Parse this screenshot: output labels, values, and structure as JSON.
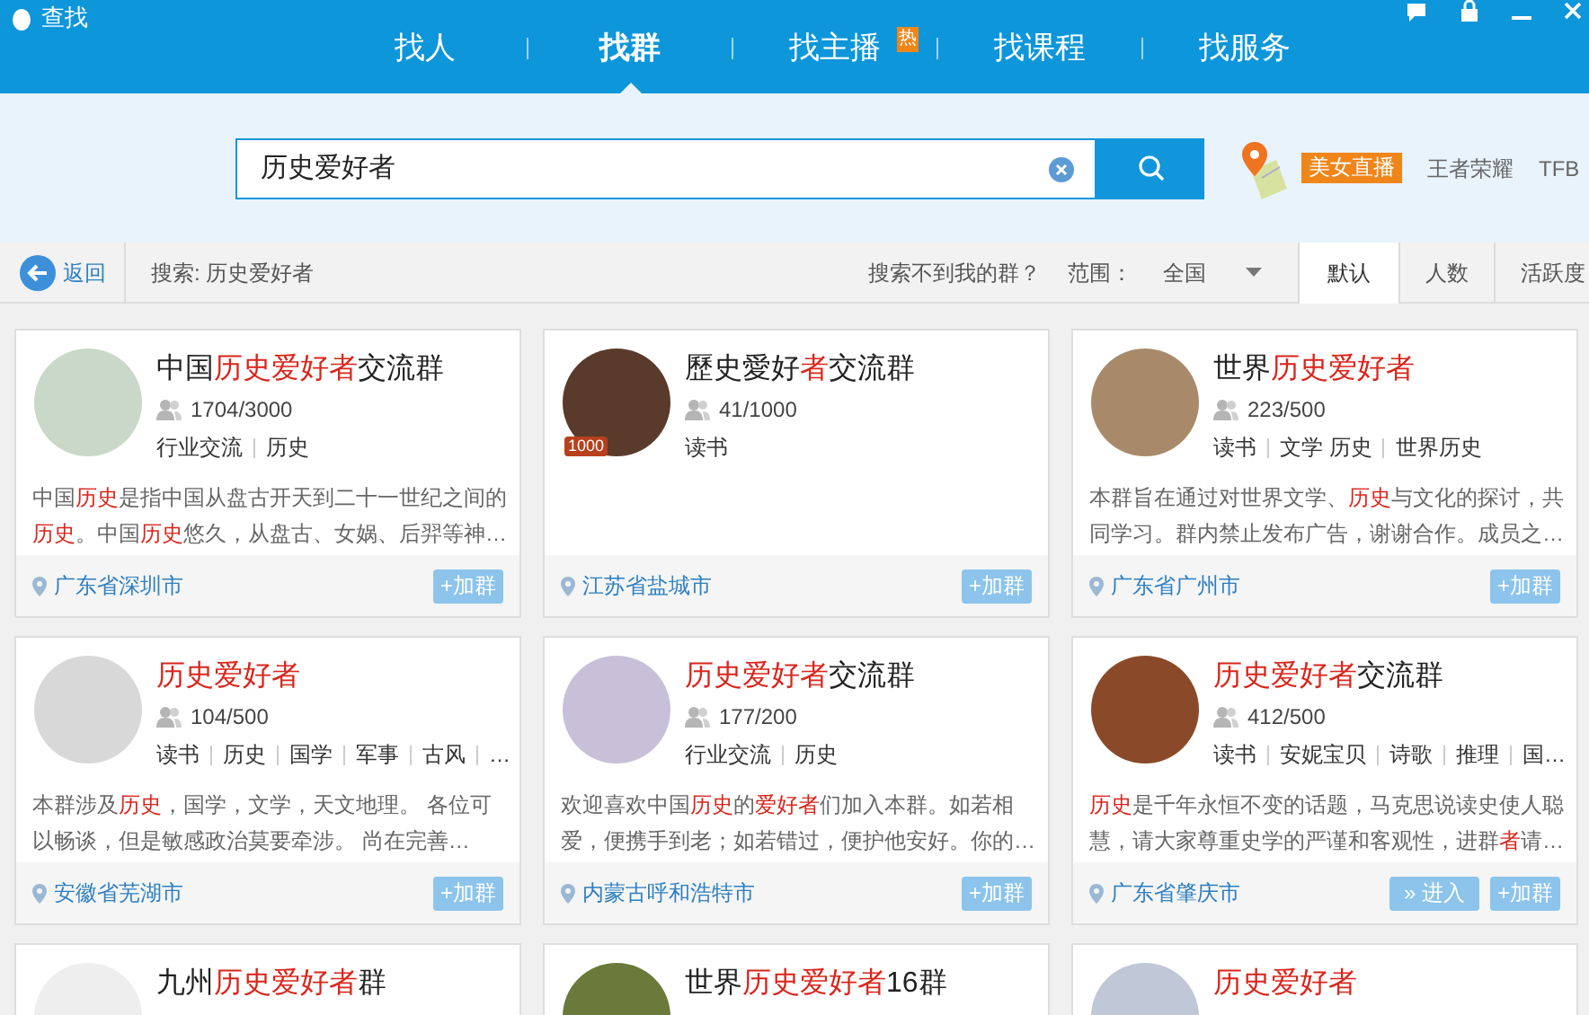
{
  "window": {
    "title": "查找"
  },
  "nav": [
    {
      "label": "找人",
      "selected": false
    },
    {
      "label": "找群",
      "selected": true
    },
    {
      "label": "找主播",
      "selected": false,
      "badge": "热"
    },
    {
      "label": "找课程",
      "selected": false
    },
    {
      "label": "找服务",
      "selected": false
    }
  ],
  "search": {
    "value": "历史爱好者"
  },
  "hot_tags": [
    {
      "label": "美女直播",
      "kind": "badge"
    },
    {
      "label": "王者荣耀",
      "kind": "plain"
    },
    {
      "label": "TFB",
      "kind": "plain"
    }
  ],
  "toolbar": {
    "back": "返回",
    "query": "搜索: 历史爱好者",
    "help_link": "搜索不到我的群？",
    "scope_label": "范围：",
    "scope_value": "全国",
    "sort_tabs": [
      {
        "label": "默认",
        "selected": true
      },
      {
        "label": "人数",
        "selected": false
      },
      {
        "label": "活跃度",
        "selected": false
      }
    ]
  },
  "groups": [
    {
      "name": [
        {
          "text": "中国",
          "highlight": false
        },
        {
          "text": "历史爱好者",
          "highlight": true
        },
        {
          "text": "交流群",
          "highlight": false
        }
      ],
      "members": "1704/3000",
      "tags": [
        "行业交流",
        "历史"
      ],
      "description": [
        {
          "text": "中国",
          "highlight": false
        },
        {
          "text": "历史",
          "highlight": true
        },
        {
          "text": "是指中国从盘古开天到二十一世纪之间的",
          "highlight": false
        },
        {
          "text": "历史",
          "highlight": true
        },
        {
          "text": "。中国",
          "highlight": false
        },
        {
          "text": "历史",
          "highlight": true
        },
        {
          "text": "悠久，从盘古、女娲、后羿等神…",
          "highlight": false
        }
      ],
      "location": "广东省深圳市",
      "join": "+加群"
    },
    {
      "name": [
        {
          "text": "歷史愛好",
          "highlight": false
        },
        {
          "text": "者",
          "highlight": true
        },
        {
          "text": "交流群",
          "highlight": false
        }
      ],
      "avatar_badge": "1000",
      "members": "41/1000",
      "tags": [
        "读书"
      ],
      "location": "江苏省盐城市",
      "join": "+加群"
    },
    {
      "name": [
        {
          "text": "世界",
          "highlight": false
        },
        {
          "text": "历史爱好者",
          "highlight": true
        }
      ],
      "members": "223/500",
      "tags": [
        "读书",
        "文学 历史",
        "世界历史"
      ],
      "description": [
        {
          "text": "本群旨在通过对世界文学、",
          "highlight": false
        },
        {
          "text": "历史",
          "highlight": true
        },
        {
          "text": "与文化的探讨，共同学习。群内禁止发布广告，谢谢合作。成员之…",
          "highlight": false
        }
      ],
      "location": "广东省广州市",
      "join": "+加群"
    },
    {
      "name": [
        {
          "text": "历史爱好者",
          "highlight": true
        }
      ],
      "members": "104/500",
      "tags": [
        "读书",
        "历史",
        "国学",
        "军事",
        "古风",
        "…"
      ],
      "description": [
        {
          "text": "本群涉及",
          "highlight": false
        },
        {
          "text": "历史",
          "highlight": true
        },
        {
          "text": "，国学，文学，天文地理。 各位可以畅谈，但是敏感政治莫要牵涉。 尚在完善…",
          "highlight": false
        }
      ],
      "location": "安徽省芜湖市",
      "join": "+加群"
    },
    {
      "name": [
        {
          "text": "历史爱好者",
          "highlight": true
        },
        {
          "text": "交流群",
          "highlight": false
        }
      ],
      "members": "177/200",
      "tags": [
        "行业交流",
        "历史"
      ],
      "description": [
        {
          "text": "欢迎喜欢中国",
          "highlight": false
        },
        {
          "text": "历史",
          "highlight": true
        },
        {
          "text": "的",
          "highlight": false
        },
        {
          "text": "爱好者",
          "highlight": true
        },
        {
          "text": "们加入本群。如若相爱，便携手到老；如若错过，便护他安好。你的…",
          "highlight": false
        }
      ],
      "location": "内蒙古呼和浩特市",
      "join": "+加群"
    },
    {
      "name": [
        {
          "text": "历史爱好者",
          "highlight": true
        },
        {
          "text": "交流群",
          "highlight": false
        }
      ],
      "members": "412/500",
      "tags": [
        "读书",
        "安妮宝贝",
        "诗歌",
        "推理",
        "国…"
      ],
      "description": [
        {
          "text": "历史",
          "highlight": true
        },
        {
          "text": "是千年永恒不变的话题，马克思说读史使人聪慧，请大家尊重史学的严谨和客观性，进群",
          "highlight": false
        },
        {
          "text": "者",
          "highlight": true
        },
        {
          "text": "请…",
          "highlight": false
        }
      ],
      "location": "广东省肇庆市",
      "enter": "» 进入",
      "join": "+加群"
    },
    {
      "name": [
        {
          "text": "九州",
          "highlight": false
        },
        {
          "text": "历史爱好者",
          "highlight": true
        },
        {
          "text": "群",
          "highlight": false
        }
      ]
    },
    {
      "name": [
        {
          "text": "世界",
          "highlight": false
        },
        {
          "text": "历史爱好者",
          "highlight": true
        },
        {
          "text": "16群",
          "highlight": false
        }
      ]
    },
    {
      "name": [
        {
          "text": "历史爱好者",
          "highlight": true
        }
      ]
    }
  ]
}
